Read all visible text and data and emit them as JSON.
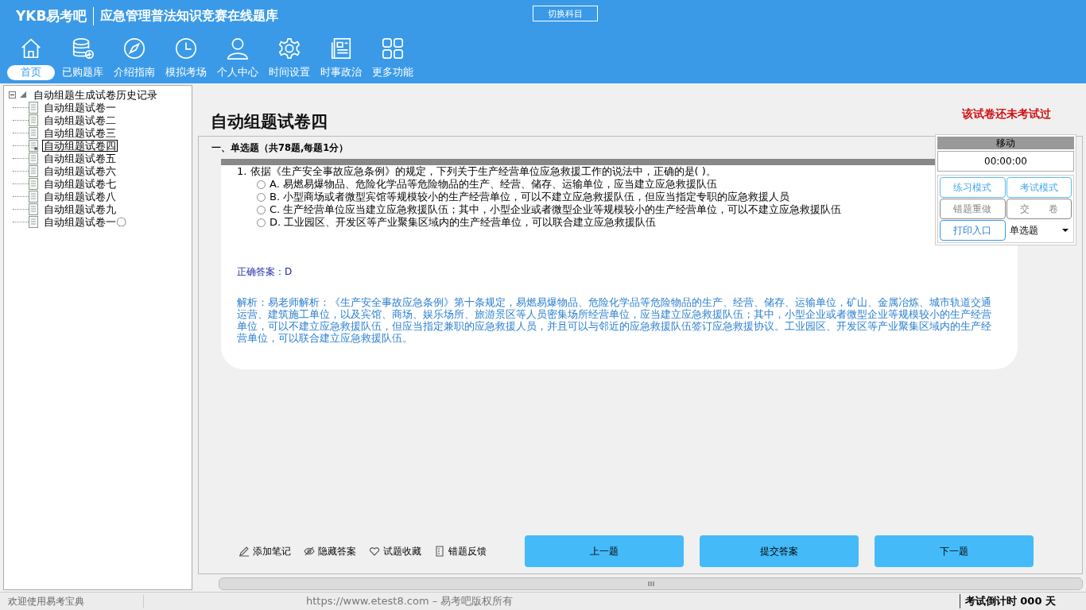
{
  "header": {
    "logo": "YKB易考吧",
    "title": "应急管理普法知识竞赛在线题库",
    "switch_button": "切换科目"
  },
  "nav": [
    {
      "label": "首页",
      "selected": true
    },
    {
      "label": "已购题库",
      "selected": false
    },
    {
      "label": "介绍指南",
      "selected": false
    },
    {
      "label": "模拟考场",
      "selected": false
    },
    {
      "label": "个人中心",
      "selected": false
    },
    {
      "label": "时间设置",
      "selected": false
    },
    {
      "label": "时事政治",
      "selected": false
    },
    {
      "label": "更多功能",
      "selected": false
    }
  ],
  "tree": {
    "label": "自动组题生成试卷历史记录",
    "expanded": true,
    "children": [
      {
        "label": "自动组题试卷一",
        "selected": false
      },
      {
        "label": "自动组题试卷二",
        "selected": false
      },
      {
        "label": "自动组题试卷三",
        "selected": false
      },
      {
        "label": "自动组题试卷四",
        "selected": true
      },
      {
        "label": "自动组题试卷五",
        "selected": false
      },
      {
        "label": "自动组题试卷六",
        "selected": false
      },
      {
        "label": "自动组题试卷七",
        "selected": false
      },
      {
        "label": "自动组题试卷八",
        "selected": false
      },
      {
        "label": "自动组题试卷九",
        "selected": false
      },
      {
        "label": "自动组题试卷一〇",
        "selected": false
      }
    ]
  },
  "paper": {
    "title": "自动组题试卷四",
    "status": "该试卷还未考试过"
  },
  "section": "一、单选题（共78题,每题1分）",
  "question": {
    "text": "1. 依据《生产安全事故应急条例》的规定，下列关于生产经营单位应急救援工作的说法中，正确的是( )。",
    "options": [
      {
        "label": "A. 易燃易爆物品、危险化学品等危险物品的生产、经营、储存、运输单位，应当建立应急救援队伍",
        "selected": false
      },
      {
        "label": "B. 小型商场或者微型宾馆等规模较小的生产经营单位，可以不建立应急救援队伍，但应当指定专职的应急救援人员",
        "selected": false
      },
      {
        "label": "C. 生产经营单位应当建立应急救援队伍；其中，小型企业或者微型企业等规模较小的生产经营单位，可以不建立应急救援队伍",
        "selected": false
      },
      {
        "label": "D. 工业园区、开发区等产业聚集区域内的生产经营单位，可以联合建立应急救援队伍",
        "selected": false
      }
    ],
    "answer": "正确答案：D",
    "analysis": "解析：易老师解析：《生产安全事故应急条例》第十条规定，易燃易爆物品、危险化学品等危险物品的生产、经营、储存、运输单位，矿山、金属冶炼、城市轨道交通运营、建筑施工单位，以及宾馆、商场、娱乐场所、旅游景区等人员密集场所经营单位，应当建立应急救援队伍；其中，小型企业或者微型企业等规模较小的生产经营单位，可以不建立应急救援队伍，但应当指定兼职的应急救援人员，并且可以与邻近的应急救援队伍签订应急救援协议。工业园区、开发区等产业聚集区域内的生产经营单位，可以联合建立应急救援队伍。"
  },
  "side_panel": {
    "title": "移动",
    "timer": "00:00:00",
    "buttons": [
      {
        "label": "练习模式",
        "kind": "primary"
      },
      {
        "label": "考试模式",
        "kind": "primary"
      },
      {
        "label": "错题重做",
        "kind": "muted"
      },
      {
        "label": "交　　卷",
        "kind": "muted"
      },
      {
        "label": "打印入口",
        "kind": "print"
      }
    ],
    "type_select": "单选题"
  },
  "tools": [
    "添加笔记",
    "隐藏答案",
    "试题收藏",
    "错题反馈"
  ],
  "actions": [
    "上一题",
    "提交答案",
    "下一题"
  ],
  "status_bar": {
    "welcome": "欢迎使用易考宝典",
    "copyright": "https://www.etest8.com – 易考吧版权所有",
    "countdown": "考试倒计时 000 天"
  }
}
